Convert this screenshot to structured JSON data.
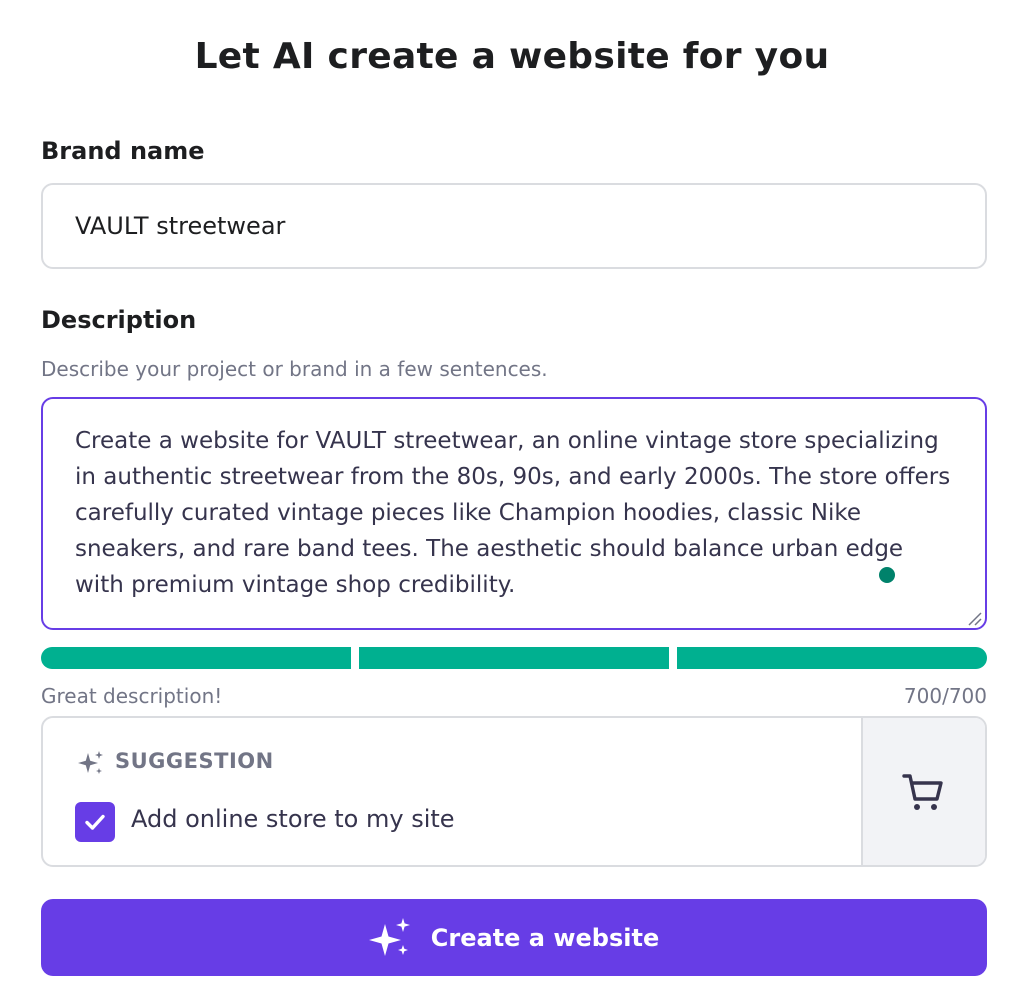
{
  "title": "Let AI create a website for you",
  "brand": {
    "label": "Brand name",
    "value": "VAULT streetwear"
  },
  "description": {
    "label": "Description",
    "hint": "Describe your project or brand in a few sentences.",
    "value": "Create a website for VAULT streetwear, an online vintage store specializing in authentic streetwear from the 80s, 90s, and early 2000s. The store offers carefully curated vintage pieces like Champion hoodies, classic Nike sneakers, and rare band tees. The aesthetic should balance urban edge with premium vintage shop credibility."
  },
  "quality_meter": {
    "status": "Great description!",
    "count": "700/700",
    "segments_filled": 3,
    "segments_total": 3
  },
  "suggestion": {
    "tag": "SUGGESTION",
    "checkbox_label": "Add online store to my site",
    "checked": true,
    "icon": "shopping-cart-icon"
  },
  "cta": {
    "label": "Create a website",
    "icon": "sparkles-icon"
  },
  "colors": {
    "primary": "#673de6",
    "success": "#00b090",
    "muted_text": "#727586",
    "border": "#dadce0"
  }
}
